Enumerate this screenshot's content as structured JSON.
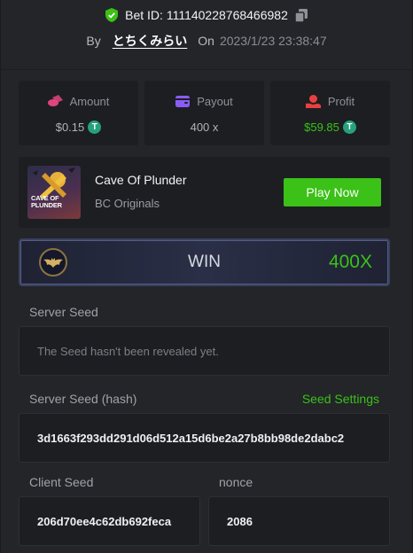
{
  "header": {
    "bet_id_label": "Bet ID: 111140228768466982",
    "by_label": "By",
    "username": "とちくみらい",
    "on_label": "On",
    "datetime": "2023/1/23 23:38:47"
  },
  "stats": [
    {
      "label": "Amount",
      "value": "$0.15",
      "icon": "coins-icon",
      "currency_icon": "tether-icon"
    },
    {
      "label": "Payout",
      "value": "400 x",
      "icon": "wallet-icon"
    },
    {
      "label": "Profit",
      "value": "$59.85",
      "icon": "profit-hand-icon",
      "currency_icon": "tether-icon"
    }
  ],
  "game": {
    "title": "Cave Of Plunder",
    "provider": "BC Originals",
    "thumb_text_1": "CAVE OF",
    "thumb_text_2": "PLUNDER",
    "play_label": "Play Now"
  },
  "result": {
    "label": "WIN",
    "multiplier": "400X"
  },
  "seeds": {
    "server_seed_label": "Server Seed",
    "server_seed_value": "The Seed hasn't been revealed yet.",
    "server_hash_label": "Server Seed (hash)",
    "seed_settings_label": "Seed Settings",
    "server_hash_value": "3d1663f293dd291d06d512a15d6be2a27b8bb98de2dabc2",
    "client_seed_label": "Client Seed",
    "client_seed_value": "206d70ee4c62db692feca",
    "nonce_label": "nonce",
    "nonce_value": "2086"
  },
  "colors": {
    "accent_green": "#3bc117",
    "background": "#232529",
    "card": "#1c1e22",
    "amount_icon": "#e0457b",
    "payout_icon": "#8a5cf6",
    "profit_icon": "#e84040",
    "tether": "#26a17b"
  }
}
